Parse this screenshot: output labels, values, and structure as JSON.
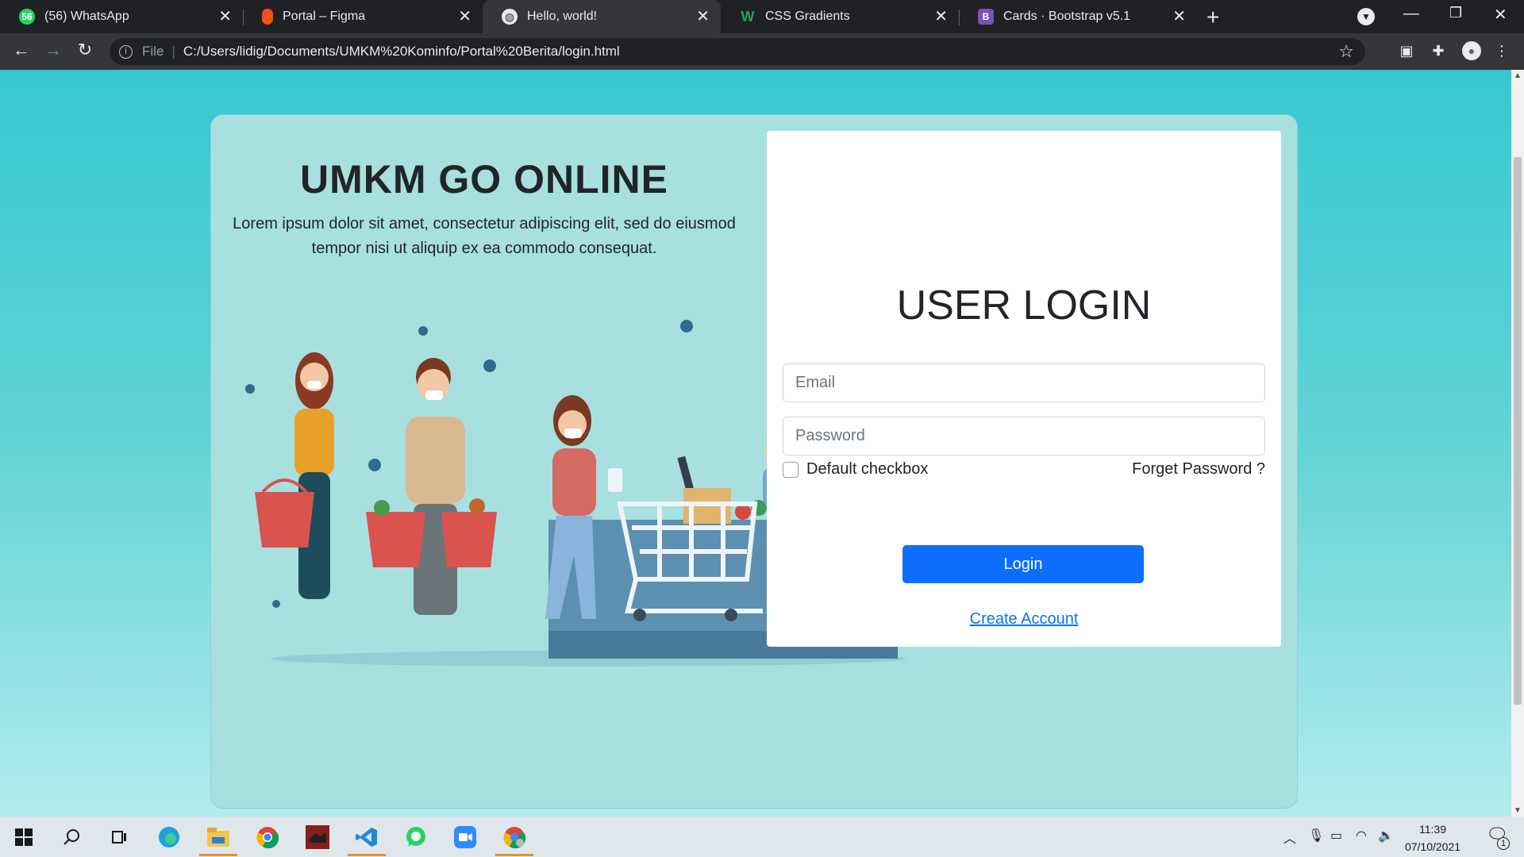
{
  "browser": {
    "tabs": [
      {
        "title": "(56) WhatsApp",
        "favicon": "whatsapp-icon",
        "badge": "56",
        "color": "#25d366"
      },
      {
        "title": "Portal – Figma",
        "favicon": "figma-icon",
        "color": "#f24e1e"
      },
      {
        "title": "Hello, world!",
        "favicon": "globe-icon",
        "color": "#9aa0a6",
        "active": true
      },
      {
        "title": "CSS Gradients",
        "favicon": "w-logo-icon",
        "color": "#1aa360"
      },
      {
        "title": "Cards · Bootstrap v5.1",
        "favicon": "bootstrap-icon",
        "color": "#7952b3"
      }
    ],
    "address": {
      "scheme_label": "File",
      "url": "C:/Users/lidig/Documents/UMKM%20Kominfo/Portal%20Berita/login.html"
    }
  },
  "page": {
    "hero": {
      "title": "UMKM GO ONLINE",
      "description": "Lorem ipsum dolor sit amet, consectetur adipiscing elit, sed do eiusmod tempor nisi ut aliquip ex ea commodo consequat."
    },
    "login": {
      "title": "USER LOGIN",
      "email_placeholder": "Email",
      "password_placeholder": "Password",
      "checkbox_label": "Default checkbox",
      "forget_link": "Forget Password ?",
      "login_button": "Login",
      "create_account_link": "Create Account"
    },
    "colors": {
      "primary": "#0d6efd",
      "background_top": "#35c9d0",
      "card": "#a8e0e0"
    }
  },
  "taskbar": {
    "time": "11:39",
    "date": "07/10/2021",
    "notification_count": "1"
  }
}
